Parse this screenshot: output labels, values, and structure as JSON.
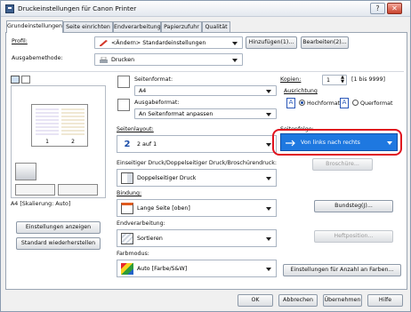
{
  "window": {
    "title": "Druckeinstellungen für Canon Printer"
  },
  "tabs": [
    "Grundeinstellungen",
    "Seite einrichten",
    "Endverarbeitung",
    "Papierzufuhr",
    "Qualität"
  ],
  "profile": {
    "label": "Profil:",
    "value": "<Ändern> Standardeinstellungen",
    "add_button": "Hinzufügen(1)...",
    "edit_button": "Bearbeiten(2)..."
  },
  "output_method": {
    "label": "Ausgabemethode:",
    "value": "Drucken"
  },
  "preview": {
    "page_left": "1",
    "page_right": "2",
    "caption": "A4 [Skalierung: Auto]"
  },
  "page_format": {
    "label": "Seitenformat:",
    "value": "A4"
  },
  "output_format": {
    "label": "Ausgabeformat:",
    "value": "An Seitenformat anpassen"
  },
  "copies": {
    "label": "Kopien:",
    "value": "1",
    "range": "[1 bis 9999]"
  },
  "orientation": {
    "label": "Ausrichtung",
    "portrait": "Hochformat",
    "landscape": "Querformat"
  },
  "page_layout": {
    "label": "Seitenlayout:",
    "value": "2 auf 1"
  },
  "page_order": {
    "label": "Seitenfolge:",
    "value": "Von links nach rechts"
  },
  "booklet_button": "Broschüre...",
  "duplex": {
    "label": "Einseitiger Druck/Doppelseitiger Druck/Broschürendruck:",
    "value": "Doppelseitiger Druck"
  },
  "binding": {
    "label": "Bindung:",
    "value": "Lange Seite [oben]",
    "gutter_button": "Bundsteg(J)..."
  },
  "finishing": {
    "label": "Endverarbeitung:",
    "value": "Sortieren",
    "staple_button": "Heftposition..."
  },
  "color_mode": {
    "label": "Farbmodus:",
    "value": "Auto [Farbe/S&W]",
    "color_count_button": "Einstellungen für Anzahl an Farben..."
  },
  "left_buttons": {
    "show_settings": "Einstellungen anzeigen",
    "restore_defaults": "Standard wiederherstellen"
  },
  "footer": {
    "ok": "OK",
    "cancel": "Abbrechen",
    "apply": "Übernehmen",
    "help": "Hilfe"
  },
  "colors": {
    "highlight": "#1e78e0",
    "alert_ring": "#e0121e"
  }
}
